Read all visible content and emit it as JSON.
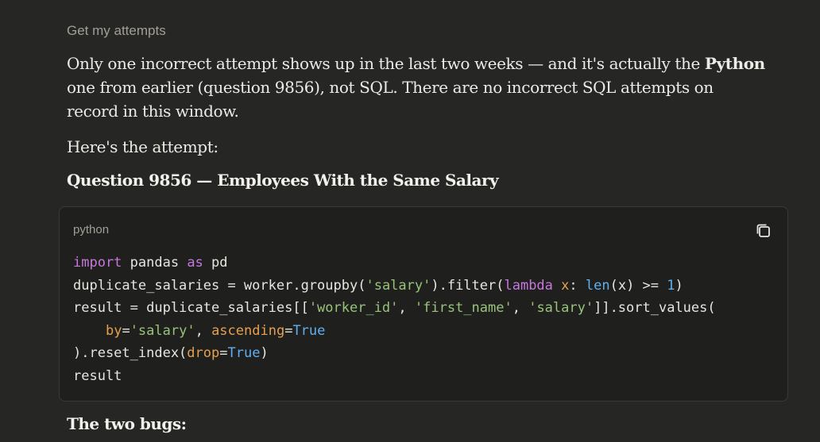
{
  "tool_label": "Get my attempts",
  "paragraph1": {
    "part1": "Only one incorrect attempt shows up in the last two weeks — and it's actually the ",
    "bold": "Python",
    "part2": " one from earlier (question 9856), not SQL. There are no incorrect SQL attempts on record in this window."
  },
  "paragraph2": "Here's the attempt:",
  "heading1": "Question 9856 — Employees With the Same Salary",
  "code_block": {
    "language": "python",
    "copy_icon": "copy-icon",
    "tokens": {
      "l1_import": "import",
      "l1_mid": " pandas ",
      "l1_as": "as",
      "l1_end": " pd",
      "l2_a": "duplicate_salaries = worker.groupby(",
      "l2_str": "'salary'",
      "l2_b": ").filter(",
      "l2_lambda": "lambda",
      "l2_x": " x",
      "l2_c": ": ",
      "l2_len": "len",
      "l2_d": "(x) >= ",
      "l2_num": "1",
      "l2_e": ")",
      "l3_a": "result = duplicate_salaries[[",
      "l3_s1": "'worker_id'",
      "l3_c1": ", ",
      "l3_s2": "'first_name'",
      "l3_c2": ", ",
      "l3_s3": "'salary'",
      "l3_b": "]].sort_values(",
      "l4_indent": "    ",
      "l4_by": "by",
      "l4_eq1": "=",
      "l4_s": "'salary'",
      "l4_c": ", ",
      "l4_asc": "ascending",
      "l4_eq2": "=",
      "l4_true": "True",
      "l5_a": ").reset_index(",
      "l5_drop": "drop",
      "l5_eq": "=",
      "l5_true": "True",
      "l5_b": ")",
      "l6": "result"
    }
  },
  "heading2": "The two bugs:"
}
